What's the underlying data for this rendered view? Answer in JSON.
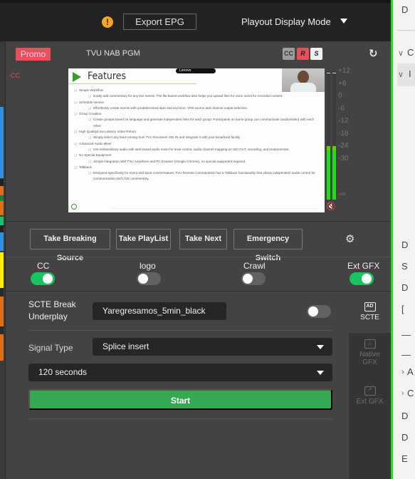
{
  "header": {
    "warning_icon": "exclamation-circle-icon",
    "export_epg_label": "Export EPG",
    "display_mode_label": "Playout Display Mode"
  },
  "left_strip": {
    "segment_colors": [
      "#3591e0",
      "#1e7a4a",
      "#e06f1a",
      "#16c46e",
      "#3591e0",
      "#ffef00",
      "#e06f1a",
      "#e06f1a"
    ]
  },
  "preview": {
    "tag": "Promo",
    "source_name": "TVU NAB PGM",
    "cc_indicator": "·CC",
    "badges": {
      "cc": "CC",
      "r": "R",
      "s": "S"
    },
    "slide": {
      "title": "Features",
      "watermark": "Lenovo",
      "items": [
        {
          "level": 1,
          "text": "Simple Workflow"
        },
        {
          "level": 2,
          "text": "Easily add commentary for any live events. The file based workflow also helps you upload files for voice overs for recorded content."
        },
        {
          "level": 1,
          "text": "Schedule service"
        },
        {
          "level": 2,
          "text": "Effortlessly create events with predetermined start and end time, VFB source and channel output selection."
        },
        {
          "level": 1,
          "text": "Group Creation"
        },
        {
          "level": 2,
          "text": "Create groups based on language and generate independent links for each group. Participants on same group can communicate (audio/video) with each other."
        },
        {
          "level": 1,
          "text": "High Quality/Low Latency Video Return"
        },
        {
          "level": 2,
          "text": "Simply select any feed coming from TVU Receivers SDI IN and integrate it with your broadcast facility"
        },
        {
          "level": 1,
          "text": "Advanced Audio Mixer"
        },
        {
          "level": 2,
          "text": "Get extraordinary audio with web based audio mixer for level control, audio channel mapping on SDI OUT, recording, and mute/unmute."
        },
        {
          "level": 1,
          "text": "No Special Equipment"
        },
        {
          "level": 2,
          "text": "Simple integration with TVU Anywhere and PC browser (Google Chrome), no special equipment required."
        },
        {
          "level": 1,
          "text": "Talkback"
        },
        {
          "level": 2,
          "text": "Designed specifically for event and sport commentators, TVU Remote Commentator has a Talkback functionality that allows independent audio control for communication and LIVE commentary."
        }
      ]
    },
    "audio_meter": {
      "scale": [
        "+12",
        "+6",
        "0",
        "-6",
        "-12",
        "-18",
        "-24",
        "-30",
        "-∞"
      ],
      "left_level_db": -24,
      "right_level_db": -24,
      "muted": true
    }
  },
  "actions": {
    "take_breaking_source": "Take Breaking Source",
    "take_playlist": "Take PlayList",
    "take_next": "Take Next",
    "emergency_switch": "Emergency Switch"
  },
  "toggles": [
    {
      "label": "CC",
      "on": true
    },
    {
      "label": "logo",
      "on": false
    },
    {
      "label": "Crawl",
      "on": false
    },
    {
      "label": "Ext GFX",
      "on": true
    }
  ],
  "scte": {
    "break_underplay_label_1": "SCTE Break",
    "break_underplay_label_2": "Underplay",
    "break_underplay_value": "Yaregresamos_5min_black",
    "underplay_enabled": false,
    "signal_type_label": "Signal Type",
    "signal_type_value": "Splice insert",
    "duration_value": "120 seconds",
    "start_label": "Start"
  },
  "side_tabs": [
    {
      "label": "SCTE",
      "icon": "ad-monitor-icon",
      "active": true
    },
    {
      "label_1": "Native",
      "label_2": "GFX",
      "icon": "image-icon",
      "active": false
    },
    {
      "label": "Ext GFX",
      "icon": "external-image-icon",
      "active": false
    }
  ],
  "right_panel": {
    "items": [
      "D",
      "C",
      "I",
      "D",
      "S",
      "D",
      "[",
      "—",
      "—",
      "A",
      "C",
      "D",
      "D",
      "E"
    ]
  }
}
